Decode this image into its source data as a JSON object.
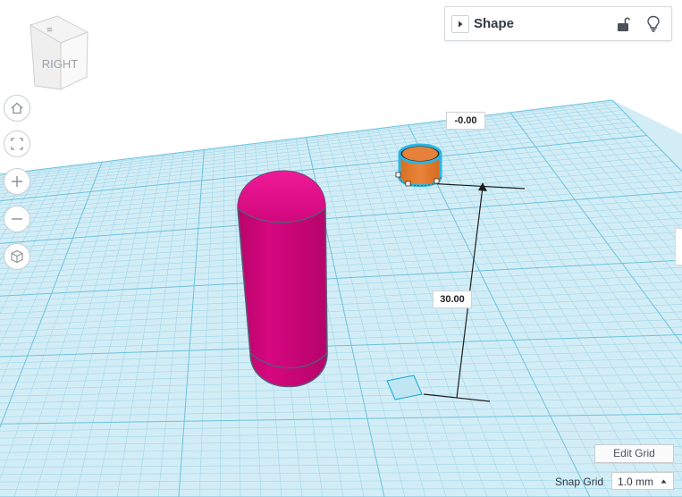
{
  "view_cube": {
    "face_label": "RIGHT"
  },
  "nav": {
    "home": "home-icon",
    "fit": "fit-all-icon",
    "zoom_in": "zoom-in-icon",
    "zoom_out": "zoom-out-icon",
    "ortho": "perspective-cube-icon"
  },
  "shape_panel": {
    "title": "Shape",
    "lock_icon": "unlock-icon",
    "light_icon": "lightbulb-icon"
  },
  "dimensions": {
    "elevation_top": "-0.00",
    "height": "30.00"
  },
  "grid": {
    "edit_label": "Edit Grid",
    "snap_label": "Snap Grid",
    "snap_value": "1.0 mm"
  },
  "colors": {
    "workplane": "#cfeaf4",
    "grid_line": "#8fd0e6",
    "capsule": "#d6067f",
    "cylinder": "#e07b2e",
    "selection": "#29b6e6"
  }
}
